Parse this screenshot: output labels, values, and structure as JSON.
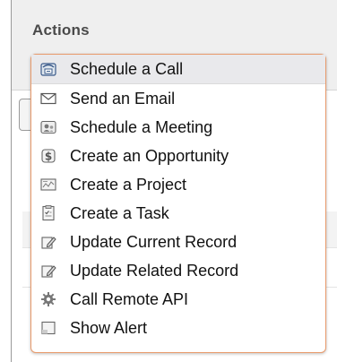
{
  "panel": {
    "title": "Actions"
  },
  "menu": {
    "items": [
      {
        "label": "Schedule a Call",
        "icon": "phone-icon",
        "highlighted": true
      },
      {
        "label": "Send an Email",
        "icon": "envelope-icon",
        "highlighted": false
      },
      {
        "label": "Schedule a Meeting",
        "icon": "meeting-icon",
        "highlighted": false
      },
      {
        "label": "Create an Opportunity",
        "icon": "dollar-icon",
        "highlighted": false
      },
      {
        "label": "Create a Project",
        "icon": "project-icon",
        "highlighted": false
      },
      {
        "label": "Create a Task",
        "icon": "task-icon",
        "highlighted": false
      },
      {
        "label": "Update Current Record",
        "icon": "edit-icon",
        "highlighted": false
      },
      {
        "label": "Update Related Record",
        "icon": "edit-related-icon",
        "highlighted": false
      },
      {
        "label": "Call Remote API",
        "icon": "gear-icon",
        "highlighted": false
      },
      {
        "label": "Show Alert",
        "icon": "alert-icon",
        "highlighted": false
      }
    ]
  },
  "colors": {
    "menu_border": "#e89a6b",
    "highlight": "#e9e9ec",
    "header_bg": "#efefef"
  }
}
